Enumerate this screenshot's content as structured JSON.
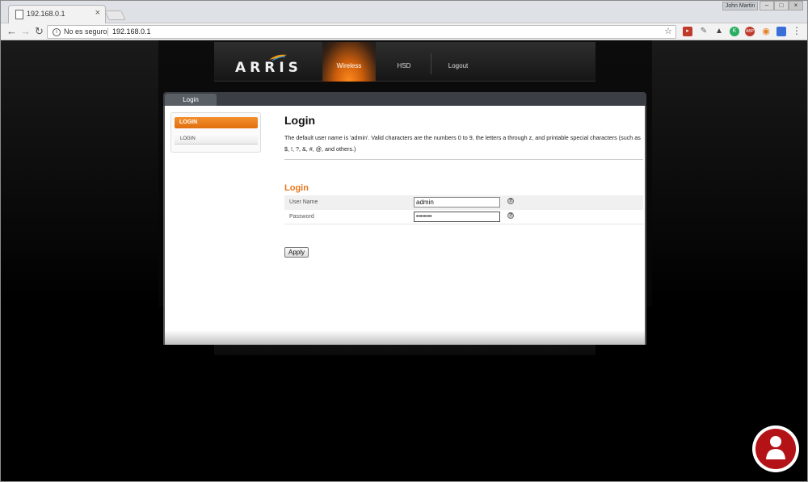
{
  "browser": {
    "tab_title": "192.168.0.1",
    "tab_close": "×",
    "user_name": "John Martin",
    "security_label": "No es seguro",
    "url": "192.168.0.1",
    "window_controls": [
      "–",
      "□",
      "×"
    ],
    "nav_icons": [
      "arrow-left-icon",
      "arrow-right-icon",
      "reload-icon"
    ]
  },
  "router": {
    "brand": "ARRIS",
    "nav": [
      "Wireless",
      "HSD",
      "Logout"
    ],
    "active_nav": "Wireless",
    "accent_color": "#e8761c"
  },
  "panel": {
    "tab_label": "Login",
    "side_menu": {
      "active_item": "LOGIN",
      "sub_item": "LOGIN"
    },
    "title": "Login",
    "description": "The default user name is 'admin'. Valid characters are the numbers 0 to 9, the letters a through z, and printable special characters (such as $, !, ?, &, #, @, and others.)",
    "section_title": "Login",
    "fields": [
      {
        "label": "User Name",
        "value": "admin"
      },
      {
        "label": "Password",
        "value": "••••••••"
      }
    ],
    "help_glyph": "?",
    "apply_label": "Apply"
  }
}
